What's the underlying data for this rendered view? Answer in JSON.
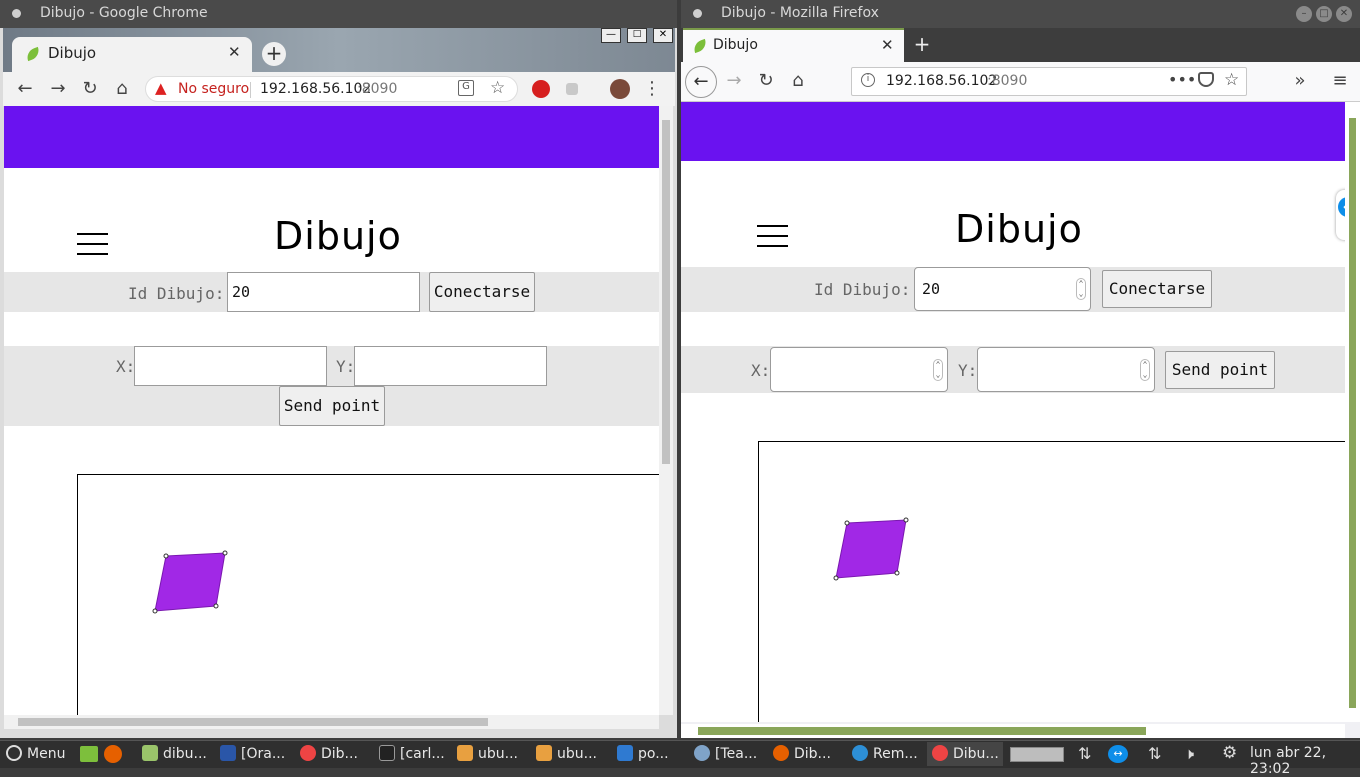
{
  "chrome": {
    "window_title": "Dibujo - Google Chrome",
    "tab_title": "Dibujo",
    "insecure_label": "No seguro",
    "url_host": "192.168.56.102",
    "url_port": ":8090",
    "page": {
      "heading": "Dibujo",
      "id_label": "Id Dibujo:",
      "id_value": "20",
      "connect_label": "Conectarse",
      "x_label": "X:",
      "y_label": "Y:",
      "send_label": "Send point"
    }
  },
  "firefox": {
    "window_title": "Dibujo - Mozilla Firefox",
    "tab_title": "Dibujo",
    "url_host": "192.168.56.102",
    "url_port": ":8090",
    "page": {
      "heading": "Dibujo",
      "id_label": "Id Dibujo:",
      "id_value": "20",
      "connect_label": "Conectarse",
      "x_label": "X:",
      "y_label": "Y:",
      "send_label": "Send point"
    }
  },
  "colors": {
    "header_bar": "#6a12f0",
    "polygon_fill": "#a128e6"
  },
  "taskbar": {
    "menu_label": "Menu",
    "items": [
      "dibu...",
      "[Ora...",
      "Dib...",
      "[carl...",
      "ubu...",
      "ubu...",
      "po...",
      "[Tea...",
      "Dib...",
      "Rem...",
      "Dibu..."
    ],
    "clock": "lun abr 22, 23:02"
  }
}
